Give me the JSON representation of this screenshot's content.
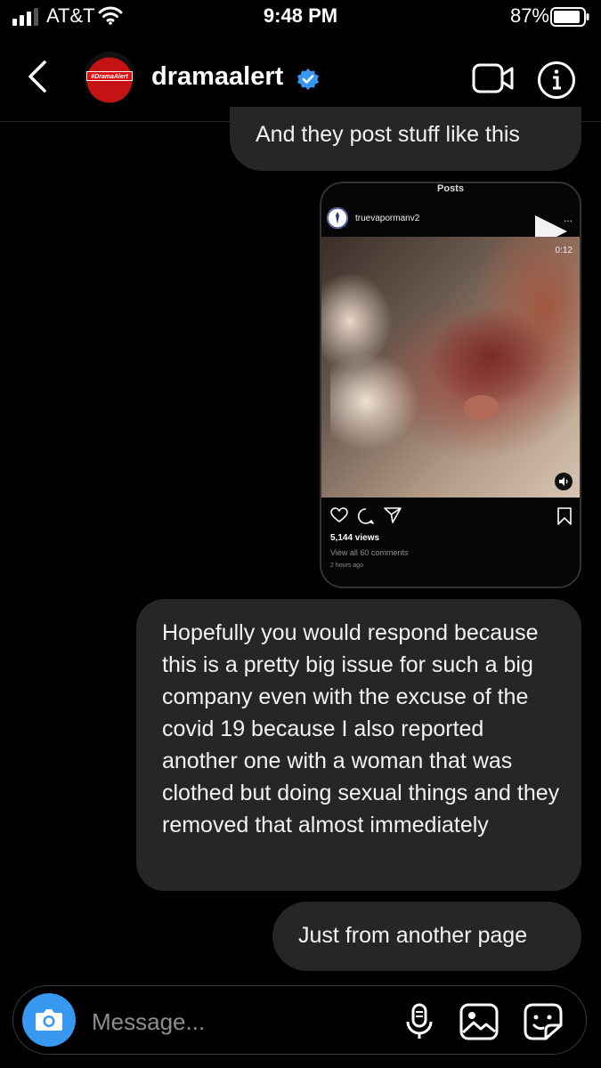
{
  "status_bar": {
    "carrier": "AT&T",
    "time": "9:48 PM",
    "battery": "87%"
  },
  "header": {
    "username": "dramaalert",
    "avatar_text": "#DramaAlert",
    "icons": [
      "back-icon",
      "verified-icon",
      "video-call-icon",
      "info-icon"
    ]
  },
  "messages": [
    {
      "type": "text",
      "text": "And they post stuff like this"
    },
    {
      "type": "shared_post",
      "header": "Posts",
      "username": "truevapormanv2",
      "more": "...",
      "duration": "0:12",
      "views": "5,144 views",
      "comments": "View all 60 comments",
      "time": "2 hours ago"
    },
    {
      "type": "text",
      "text": "Hopefully you would respond because this is a pretty big issue for such a big company even with the excuse of the covid 19 because I also reported another one with a woman that was clothed but doing sexual things and they removed that almost immediately"
    },
    {
      "type": "text",
      "text": "Just from another page"
    }
  ],
  "composer": {
    "placeholder": "Message...",
    "icons": [
      "camera-icon",
      "microphone-icon",
      "gallery-icon",
      "sticker-icon"
    ]
  },
  "colors": {
    "background": "#000000",
    "bubble": "#262626",
    "camera_button": "#3897f0",
    "verified": "#3897f0"
  }
}
